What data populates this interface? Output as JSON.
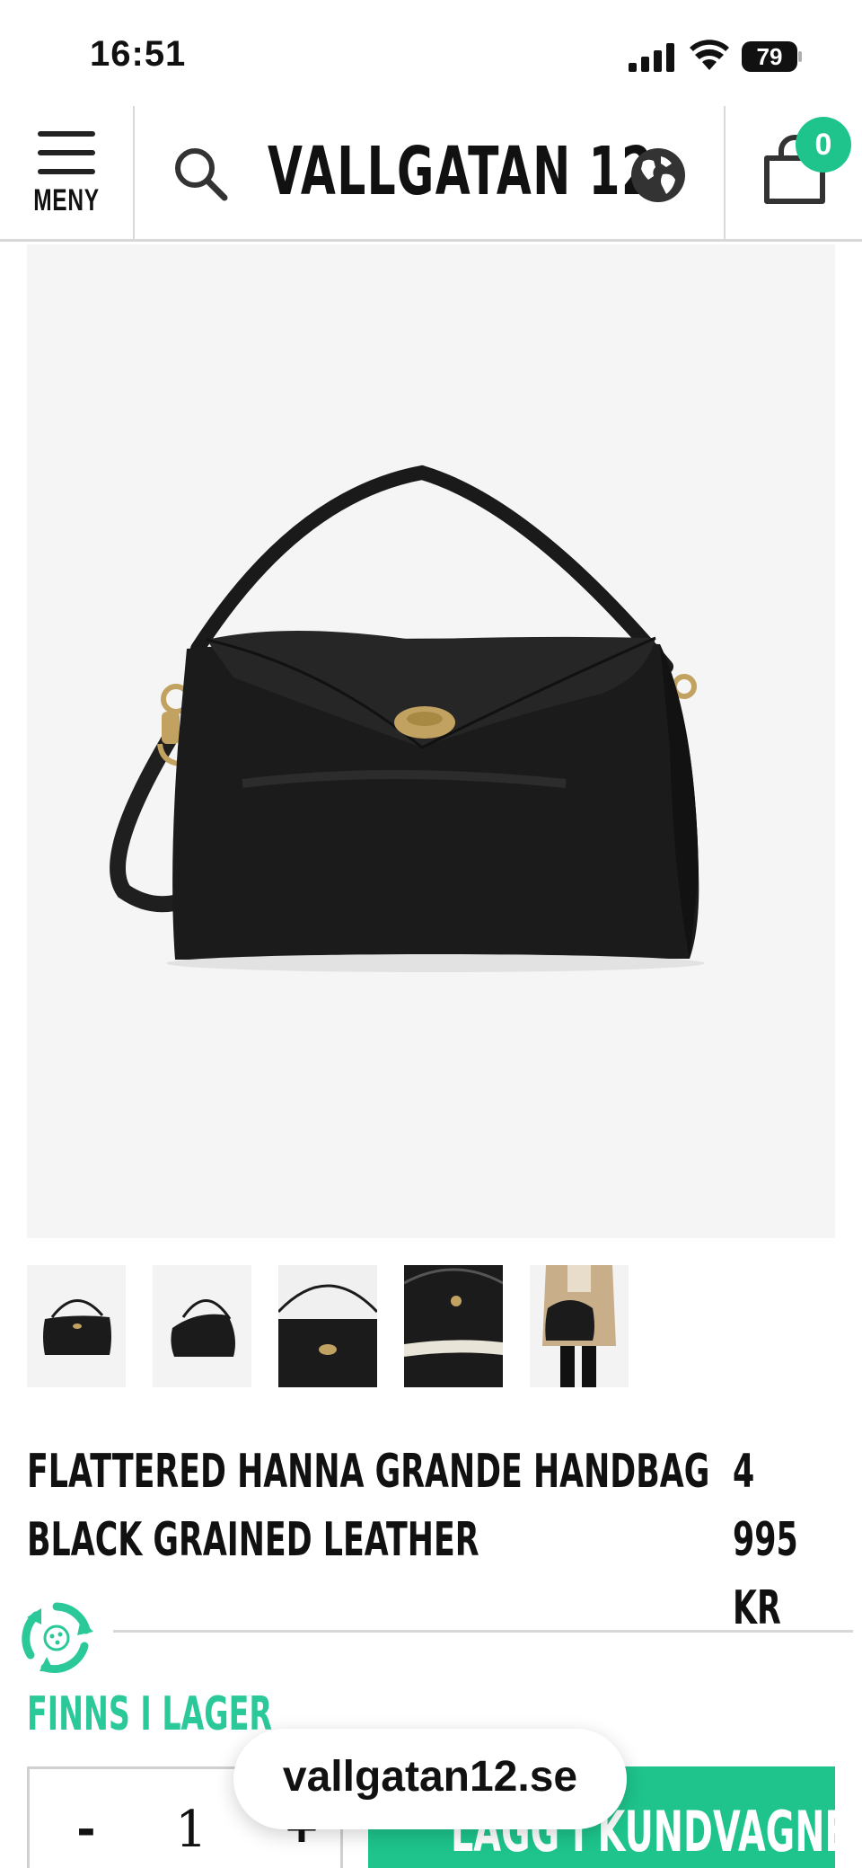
{
  "status_bar": {
    "time": "16:51",
    "battery": "79"
  },
  "header": {
    "menu_label": "MENY",
    "logo": "VALLGATAN 12",
    "cart_count": "0",
    "icons": [
      "menu-icon",
      "search-icon",
      "globe-icon",
      "shopping-bag-icon"
    ]
  },
  "product": {
    "title": "FLATTERED HANNA GRANDE HANDBAG BLACK GRAINED LEATHER",
    "price": "4 995 KR",
    "thumbnails": [
      "front",
      "side",
      "closeup-clasp",
      "interior",
      "worn-by-model"
    ],
    "stock_status": "FINNS I LAGER",
    "quantity": "1",
    "qty_minus": "-",
    "qty_plus": "+",
    "add_to_cart_label": "LÄGG I KUNDVAGNEN"
  },
  "browser": {
    "url": "vallgatan12.se"
  },
  "colors": {
    "accent": "#1ec48c",
    "stock": "#2bc99a",
    "bag": "#1b1b1b",
    "hardware": "#c2a261"
  }
}
